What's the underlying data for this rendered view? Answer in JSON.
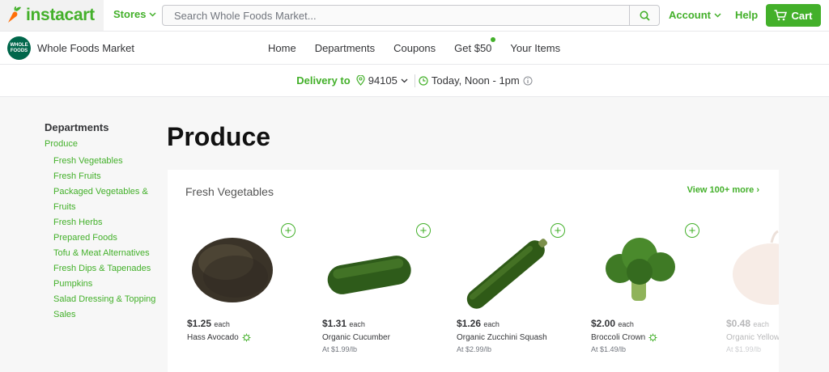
{
  "brand": {
    "name": "instacart"
  },
  "header": {
    "stores_label": "Stores",
    "search_placeholder": "Search Whole Foods Market...",
    "account_label": "Account",
    "help_label": "Help",
    "cart_label": "Cart"
  },
  "store": {
    "logo_text": "WHOLE FOODS",
    "name": "Whole Foods Market",
    "nav": [
      "Home",
      "Departments",
      "Coupons",
      "Get $50",
      "Your Items"
    ]
  },
  "delivery": {
    "label": "Delivery to",
    "zip": "94105",
    "time": "Today, Noon - 1pm"
  },
  "sidebar": {
    "title": "Departments",
    "root": "Produce",
    "items": [
      "Fresh Vegetables",
      "Fresh Fruits",
      "Packaged Vegetables &",
      "Fruits",
      "Fresh Herbs",
      "Prepared Foods",
      "Tofu & Meat Alternatives",
      "Fresh Dips & Tapenades",
      "Pumpkins",
      "Salad Dressing & Topping",
      "Sales"
    ]
  },
  "main": {
    "title": "Produce",
    "section_title": "Fresh Vegetables",
    "view_more": "View 100+ more ›",
    "products": [
      {
        "price": "$1.25",
        "unit": "each",
        "name": "Hass Avocado",
        "note": "",
        "organic_icon": true
      },
      {
        "price": "$1.31",
        "unit": "each",
        "name": "Organic Cucumber",
        "note": "At $1.99/lb",
        "organic_icon": false
      },
      {
        "price": "$1.26",
        "unit": "each",
        "name": "Organic Zucchini Squash",
        "note": "At $2.99/lb",
        "organic_icon": false
      },
      {
        "price": "$2.00",
        "unit": "each",
        "name": "Broccoli Crown",
        "note": "At $1.49/lb",
        "organic_icon": true
      },
      {
        "price": "$0.48",
        "unit": "each",
        "name": "Organic Yellow",
        "note": "At $1.99/lb",
        "organic_icon": false
      }
    ]
  },
  "colors": {
    "accent": "#43b02a",
    "text": "#343538"
  }
}
